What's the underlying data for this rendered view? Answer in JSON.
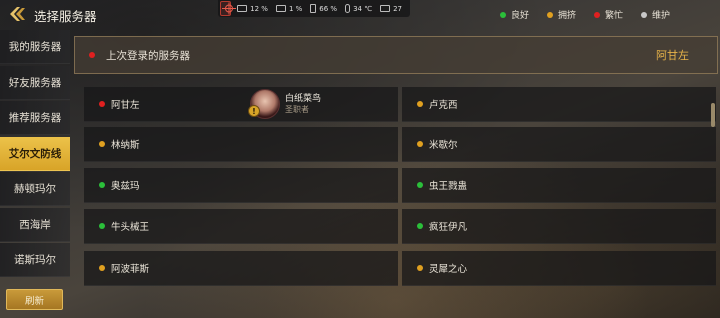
{
  "header": {
    "title": "选择服务器",
    "status": {
      "cpu": "12 %",
      "mem": "1 %",
      "battery": "66 %",
      "temp": "34 ℃",
      "storage": "27"
    },
    "legend": [
      {
        "label": "良好",
        "color": "#2bbf3a"
      },
      {
        "label": "拥挤",
        "color": "#e0a020"
      },
      {
        "label": "繁忙",
        "color": "#e02020"
      },
      {
        "label": "维护",
        "color": "#c8c8c8"
      }
    ]
  },
  "sidebar": {
    "items": [
      {
        "label": "我的服务器",
        "active": false
      },
      {
        "label": "好友服务器",
        "active": false
      },
      {
        "label": "推荐服务器",
        "active": false
      },
      {
        "label": "艾尔文防线",
        "active": true
      },
      {
        "label": "赫顿玛尔",
        "active": false
      },
      {
        "label": "西海岸",
        "active": false
      },
      {
        "label": "诺斯玛尔",
        "active": false
      }
    ],
    "refresh_label": "刷新"
  },
  "last_login": {
    "label": "上次登录的服务器",
    "server": "阿甘左",
    "status_color": "#e02020"
  },
  "servers": [
    {
      "name": "阿甘左",
      "color": "#e02020"
    },
    {
      "name": "卢克西",
      "color": "#e0a020"
    },
    {
      "name": "林纳斯",
      "color": "#e0a020"
    },
    {
      "name": "米歇尔",
      "color": "#e0a020"
    },
    {
      "name": "奥兹玛",
      "color": "#2bbf3a"
    },
    {
      "name": "虫王戮蛊",
      "color": "#2bbf3a"
    },
    {
      "name": "牛头械王",
      "color": "#2bbf3a"
    },
    {
      "name": "疯狂伊凡",
      "color": "#2bbf3a"
    },
    {
      "name": "阿波菲斯",
      "color": "#e0a020"
    },
    {
      "name": "灵犀之心",
      "color": "#e0a020"
    }
  ],
  "character": {
    "name": "白纸菜鸟",
    "class": "圣职者",
    "badge": "!"
  }
}
